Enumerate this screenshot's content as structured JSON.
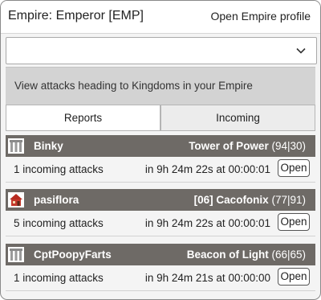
{
  "header": {
    "title": "Empire: Emperor [EMP]",
    "profile_link": "Open Empire profile"
  },
  "kingdom_select": {
    "selected": ""
  },
  "info": {
    "text": "View attacks heading to Kingdoms in your Empire"
  },
  "tabs": [
    {
      "label": "Reports",
      "active": true
    },
    {
      "label": "Incoming",
      "active": false
    }
  ],
  "colors": {
    "group_header_bg": "#6e6a66",
    "info_panel_bg": "#d3d3d3"
  },
  "groups": [
    {
      "emblem": "castle-gate-icon",
      "player": "Binky",
      "kingdom_name": "Tower of Power",
      "kingdom_coords": "(94|30)",
      "incoming_text": "1 incoming attacks",
      "eta_text": "in 9h 24m 22s at 00:00:01",
      "open_label": "Open"
    },
    {
      "emblem": "red-house-icon",
      "player": "pasiflora",
      "kingdom_name": "[06] Cacofonix",
      "kingdom_coords": "(77|91)",
      "incoming_text": "5 incoming attacks",
      "eta_text": "in 9h 24m 22s at 00:00:01",
      "open_label": "Open"
    },
    {
      "emblem": "castle-gate-icon",
      "player": "CptPoopyFarts",
      "kingdom_name": "Beacon of Light",
      "kingdom_coords": "(66|65)",
      "incoming_text": "1 incoming attacks",
      "eta_text": "in 9h 24m 21s at 00:00:00",
      "open_label": "Open"
    }
  ]
}
